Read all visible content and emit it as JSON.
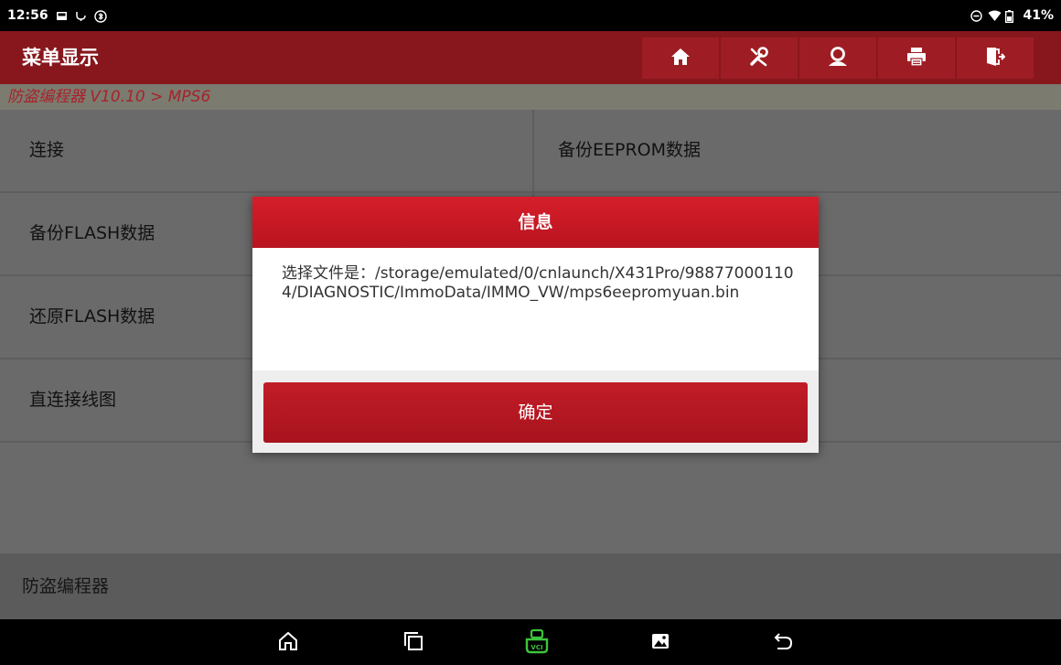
{
  "status_bar": {
    "time": "12:56",
    "battery": "41%"
  },
  "header": {
    "title": "菜单显示",
    "toolbar": [
      {
        "name": "home-icon"
      },
      {
        "name": "diagnostic-tools-icon"
      },
      {
        "name": "user-icon"
      },
      {
        "name": "print-icon"
      },
      {
        "name": "exit-icon"
      }
    ]
  },
  "breadcrumb": "防盗编程器 V10.10 > MPS6",
  "menu": {
    "items": [
      {
        "label": "连接"
      },
      {
        "label": "备份EEPROM数据"
      },
      {
        "label": "备份FLASH数据"
      },
      {
        "label": ""
      },
      {
        "label": "还原FLASH数据"
      },
      {
        "label": ""
      },
      {
        "label": "直连接线图"
      },
      {
        "label": ""
      }
    ]
  },
  "footer": {
    "label": "防盗编程器"
  },
  "dialog": {
    "title": "信息",
    "message": "选择文件是：/storage/emulated/0/cnlaunch/X431Pro/988770001104/DIAGNOSTIC/ImmoData/IMMO_VW/mps6eepromyuan.bin",
    "ok_label": "确定"
  },
  "nav_bar": {
    "items": [
      "home-icon",
      "recent-apps-icon",
      "vci-icon",
      "screenshot-icon",
      "back-icon"
    ],
    "vci_label": "VCI"
  },
  "colors": {
    "brand_dark": "#87171d",
    "dialog_red": "#c8192a",
    "vci_green": "#3cc43c"
  }
}
